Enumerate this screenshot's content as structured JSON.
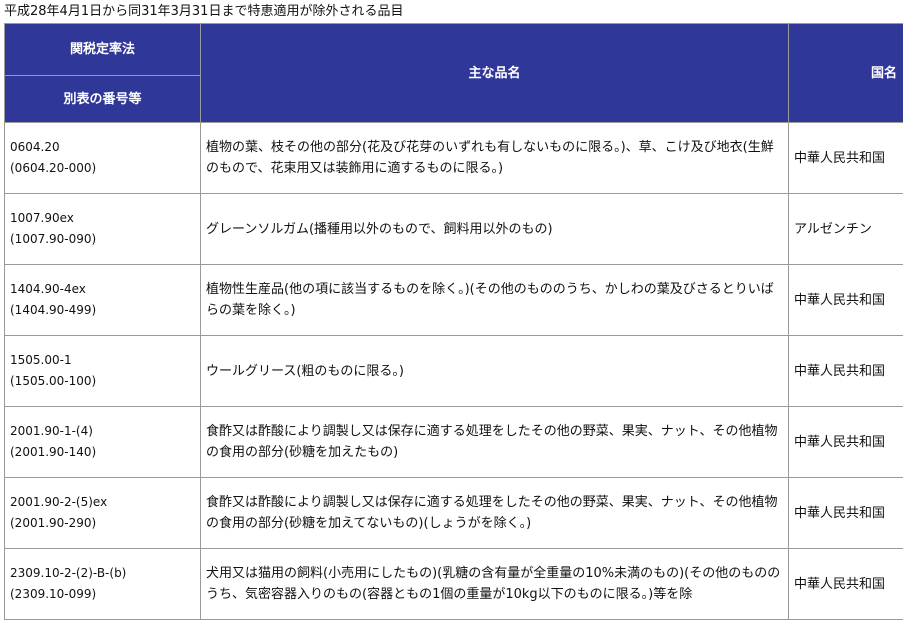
{
  "caption": "平成28年4月1日から同31年3月31日まで特恵適用が除外される品目",
  "table": {
    "header": {
      "tariff_rate_law": "関税定率法",
      "annex_number": "別表の番号等",
      "item_name": "主な品名",
      "country": "国名"
    },
    "rows": [
      {
        "code": "0604.20",
        "stat_code": "(0604.20-000)",
        "item": "植物の葉、枝その他の部分(花及び花芽のいずれも有しないものに限る。)、草、こけ及び地衣(生鮮のもので、花束用又は装飾用に適するものに限る。)",
        "country": "中華人民共和国"
      },
      {
        "code": "1007.90ex",
        "stat_code": "(1007.90-090)",
        "item": "グレーンソルガム(播種用以外のもので、飼料用以外のもの)",
        "country": "アルゼンチン"
      },
      {
        "code": "1404.90-4ex",
        "stat_code": "(1404.90-499)",
        "item": "植物性生産品(他の項に該当するものを除く。)(その他のもののうち、かしわの葉及びさるとりいばらの葉を除く。)",
        "country": "中華人民共和国"
      },
      {
        "code": "1505.00-1",
        "stat_code": "(1505.00-100)",
        "item": "ウールグリース(粗のものに限る。)",
        "country": "中華人民共和国"
      },
      {
        "code": "2001.90-1-(4)",
        "stat_code": "(2001.90-140)",
        "item": "食酢又は酢酸により調製し又は保存に適する処理をしたその他の野菜、果実、ナット、その他植物の食用の部分(砂糖を加えたもの)",
        "country": "中華人民共和国"
      },
      {
        "code": "2001.90-2-(5)ex",
        "stat_code": "(2001.90-290)",
        "item": "食酢又は酢酸により調製し又は保存に適する処理をしたその他の野菜、果実、ナット、その他植物の食用の部分(砂糖を加えてないもの)(しょうがを除く。)",
        "country": "中華人民共和国"
      },
      {
        "code": "2309.10-2-(2)-B-(b)",
        "stat_code": "(2309.10-099)",
        "item": "犬用又は猫用の飼料(小売用にしたもの)(乳糖の含有量が全重量の10%未満のもの)(その他のもののうち、気密容器入りのもの(容器ともの1個の重量が10kg以下のものに限る。)等を除",
        "country": "中華人民共和国"
      }
    ]
  }
}
